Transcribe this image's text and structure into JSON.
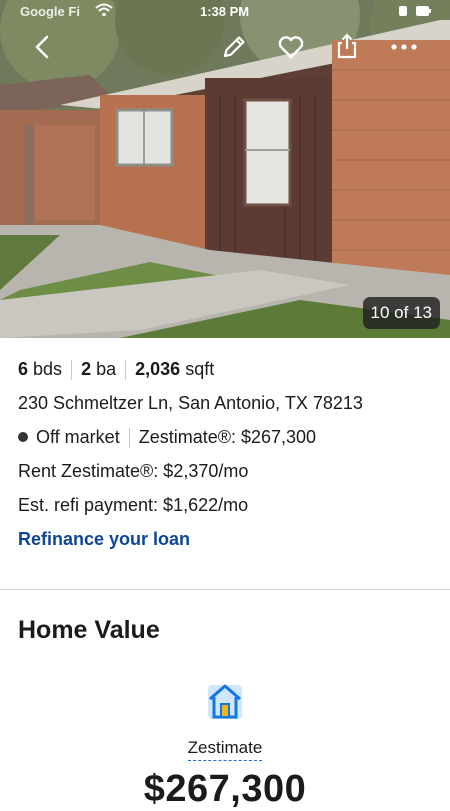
{
  "status_bar": {
    "carrier": "Google Fi",
    "time": "1:38 PM"
  },
  "gallery": {
    "counter": "10 of 13"
  },
  "facts": {
    "beds_value": "6",
    "beds_unit": "bds",
    "baths_value": "2",
    "baths_unit": "ba",
    "sqft_value": "2,036",
    "sqft_unit": "sqft"
  },
  "address": "230 Schmeltzer Ln, San Antonio, TX 78213",
  "market_status": "Off market",
  "zestimate_line": "Zestimate®: $267,300",
  "rent_zestimate": "Rent Zestimate®: $2,370/mo",
  "refi_payment": "Est. refi payment: $1,622/mo",
  "refi_link": "Refinance your loan",
  "home_value": {
    "title": "Home Value",
    "zestimate_label": "Zestimate",
    "zestimate_value": "$267,300"
  },
  "icons": [
    "back-icon",
    "edit-icon",
    "heart-icon",
    "share-icon",
    "more-icon",
    "house-icon"
  ],
  "colors": {
    "link": "#0d4599",
    "icon_blue": "#1277e1"
  }
}
